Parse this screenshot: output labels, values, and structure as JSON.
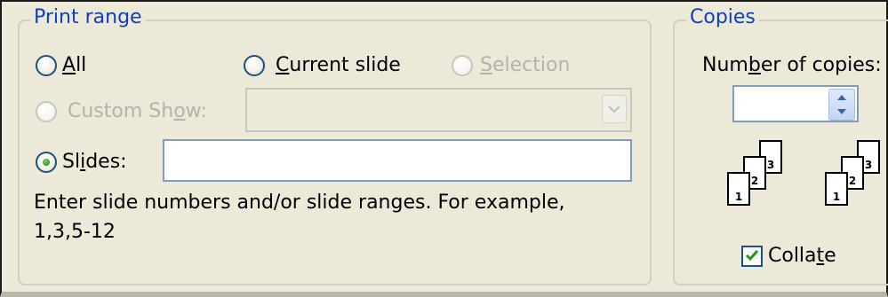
{
  "print_range": {
    "title": "Print range",
    "all_label_u": "A",
    "all_label_rest": "ll",
    "current_slide_label_u": "C",
    "current_slide_label_rest": "urrent slide",
    "selection_label_u": "S",
    "selection_label_rest": "election",
    "custom_show_label_pre": "Custom Sh",
    "custom_show_label_u": "o",
    "custom_show_label_post": "w:",
    "slides_label_pre": "Sl",
    "slides_label_u": "i",
    "slides_label_post": "des:",
    "slides_value": "",
    "help_line1": "Enter slide numbers and/or slide ranges. For example,",
    "help_line2": "1,3,5-12",
    "selected": "slides"
  },
  "copies": {
    "title": "Copies",
    "number_label_pre": "Num",
    "number_label_u": "b",
    "number_label_post": "er of copies:",
    "number_value": "",
    "collate_pre": "Colla",
    "collate_u": "t",
    "collate_post": "e",
    "collate_checked": true,
    "collated_set_pages": [
      "1",
      "2",
      "3"
    ],
    "uncollated_set_pages": [
      "1",
      "2",
      "3"
    ]
  },
  "icons": {
    "combo_arrow": "chevron-down-icon",
    "spin_up": "arrow-up-icon",
    "spin_down": "arrow-down-icon",
    "checkmark": "checkmark-icon"
  }
}
